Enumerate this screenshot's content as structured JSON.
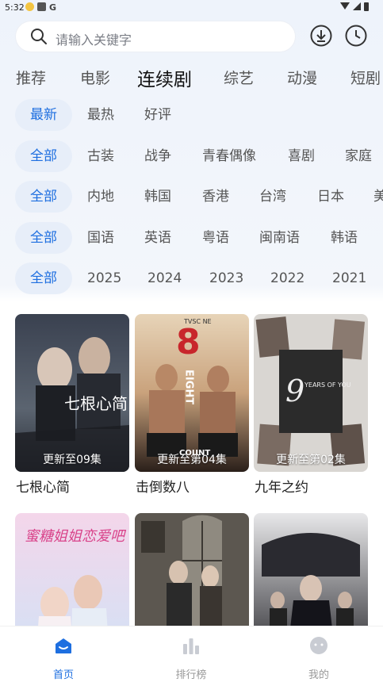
{
  "status": {
    "time": "5:32"
  },
  "search": {
    "placeholder": "请输入关键字"
  },
  "categories": [
    "推荐",
    "电影",
    "连续剧",
    "综艺",
    "动漫",
    "短剧"
  ],
  "filters": {
    "sort": [
      "最新",
      "最热",
      "好评"
    ],
    "genre": [
      "全部",
      "古装",
      "战争",
      "青春偶像",
      "喜剧",
      "家庭"
    ],
    "region": [
      "全部",
      "内地",
      "韩国",
      "香港",
      "台湾",
      "日本",
      "美"
    ],
    "language": [
      "全部",
      "国语",
      "英语",
      "粤语",
      "闽南语",
      "韩语"
    ],
    "year": [
      "全部",
      "2025",
      "2024",
      "2023",
      "2022",
      "2021"
    ]
  },
  "shows": [
    {
      "title": "七根心简",
      "badge": "更新至09集"
    },
    {
      "title": "击倒数八",
      "badge": "更新至第04集"
    },
    {
      "title": "九年之约",
      "badge": "更新至第02集"
    },
    {
      "title": "",
      "badge": ""
    },
    {
      "title": "",
      "badge": ""
    },
    {
      "title": "",
      "badge": ""
    }
  ],
  "poster_text": {
    "p1": "七根心简",
    "p2_big": "8",
    "p2_word": "EIGHT",
    "p2_count": "COUNT",
    "p2_top": "TVSC NE",
    "p3_big": "9",
    "p3_script": "YEARS OF YOU",
    "p4": "蜜糖姐姐恋爱吧"
  },
  "tabbar": [
    "首页",
    "排行榜",
    "我的"
  ],
  "colors": {
    "accent": "#1e6fe0",
    "chip_bg": "#e7eef9"
  }
}
